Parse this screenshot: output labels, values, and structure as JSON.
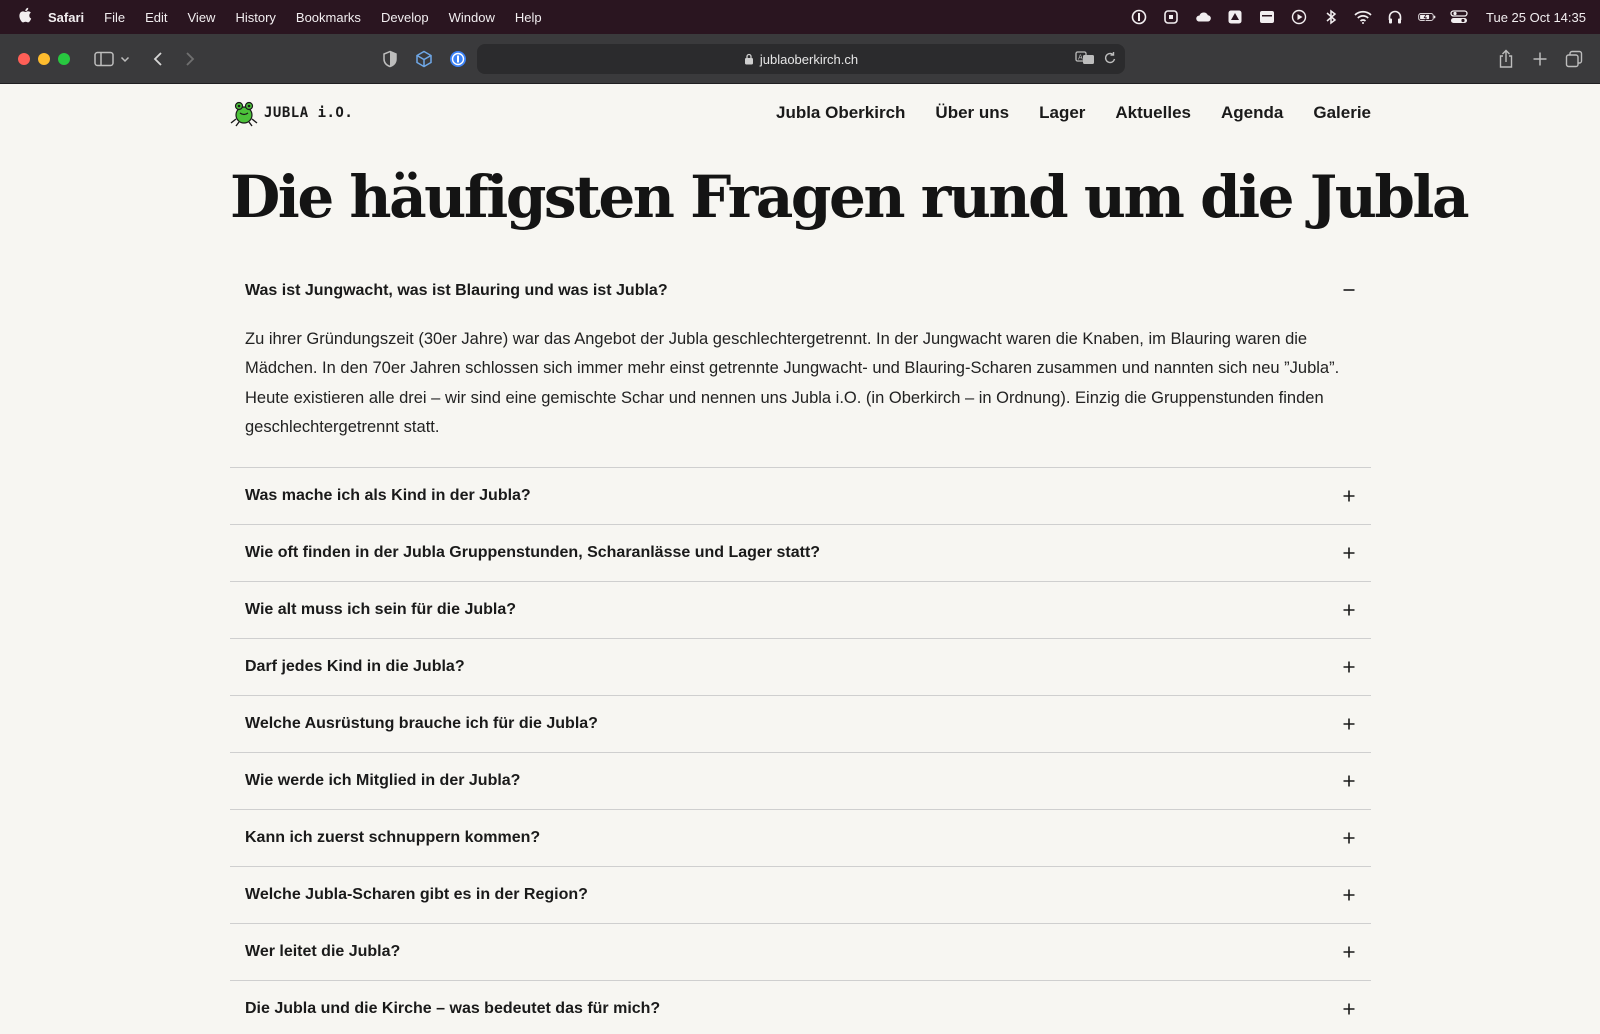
{
  "menubar": {
    "app": "Safari",
    "items": [
      "File",
      "Edit",
      "View",
      "History",
      "Bookmarks",
      "Develop",
      "Window",
      "Help"
    ],
    "clock": "Tue 25 Oct  14:35"
  },
  "browser": {
    "url": "jublaoberkirch.ch"
  },
  "site": {
    "logo_text": "JUBLA i.O.",
    "nav": [
      "Jubla Oberkirch",
      "Über uns",
      "Lager",
      "Aktuelles",
      "Agenda",
      "Galerie"
    ]
  },
  "main": {
    "title": "Die häufigsten Fragen rund um die Jubla",
    "faq": [
      {
        "question": "Was ist Jungwacht, was ist Blauring und was ist Jubla?",
        "answer": "Zu ihrer Gründungszeit (30er Jahre) war das Angebot der Jubla geschlechtergetrennt. In der Jungwacht waren die Knaben, im Blauring waren die Mädchen. In den 70er Jahren schlossen sich immer mehr einst getrennte Jungwacht- und Blauring-Scharen zusammen und nannten sich neu ”Jubla”. Heute existieren alle drei – wir sind eine gemischte Schar und nennen uns Jubla i.O. (in Oberkirch – in Ordnung). Einzig die Gruppenstunden finden geschlechtergetrennt statt.",
        "expanded": true
      },
      {
        "question": "Was mache ich als Kind in der Jubla?",
        "expanded": false
      },
      {
        "question": "Wie oft finden in der Jubla Gruppenstunden, Scharanlässe und Lager statt?",
        "expanded": false
      },
      {
        "question": "Wie alt muss ich sein für die Jubla?",
        "expanded": false
      },
      {
        "question": "Darf jedes Kind in die Jubla?",
        "expanded": false
      },
      {
        "question": "Welche Ausrüstung brauche ich für die Jubla?",
        "expanded": false
      },
      {
        "question": "Wie werde ich Mitglied in der Jubla?",
        "expanded": false
      },
      {
        "question": "Kann ich zuerst schnuppern kommen?",
        "expanded": false
      },
      {
        "question": "Welche Jubla-Scharen gibt es in der Region?",
        "expanded": false
      },
      {
        "question": "Wer leitet die Jubla?",
        "expanded": false
      },
      {
        "question": "Die Jubla und die Kirche – was bedeutet das für mich?",
        "expanded": false
      }
    ]
  },
  "colors": {
    "menubar_bg": "#2a1520",
    "toolbar_bg": "#3a3a3c",
    "page_bg": "#f7f6f2",
    "logo_green": "#4cc23a",
    "traffic_red": "#ff5f57",
    "traffic_yellow": "#febc2e",
    "traffic_green": "#28c840"
  },
  "icons": {
    "menubar_right": [
      "onepassword-icon",
      "screen-icon",
      "cloud-icon",
      "drive-icon",
      "calendar-icon",
      "play-icon",
      "bluetooth-icon",
      "wifi-icon",
      "headphones-icon",
      "battery-icon",
      "control-center-icon"
    ],
    "toolbar": [
      "sidebar-icon",
      "chevron-down-icon",
      "back-icon",
      "forward-icon",
      "shield-icon",
      "box-icon",
      "onepassword-icon",
      "lock-icon",
      "translate-icon",
      "reload-icon",
      "share-icon",
      "new-tab-icon",
      "tabs-icon"
    ]
  }
}
